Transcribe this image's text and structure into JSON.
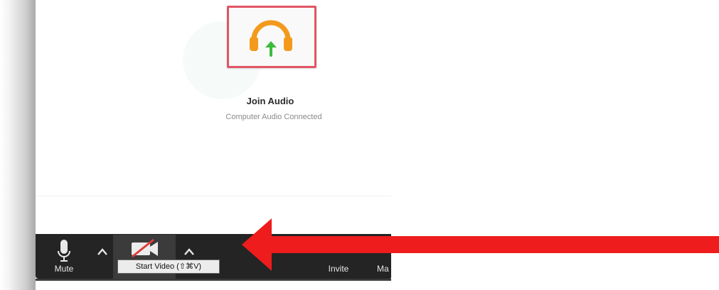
{
  "audio": {
    "label": "Join Audio",
    "status": "Computer Audio Connected",
    "icon": "headphones-icon"
  },
  "toolbar": {
    "mute_label": "Mute",
    "video_tooltip": "Start Video (⇧⌘V)",
    "invite_label": "Invite",
    "manage_label_partial": "Ma"
  },
  "colors": {
    "toolbar_bg": "#242424",
    "highlight_border": "#e15564",
    "headphones": "#f39a1c",
    "upload_arrow": "#3dbb3d",
    "annotation_arrow": "#ee1c1c",
    "video_off_slash": "#e13b3b"
  }
}
